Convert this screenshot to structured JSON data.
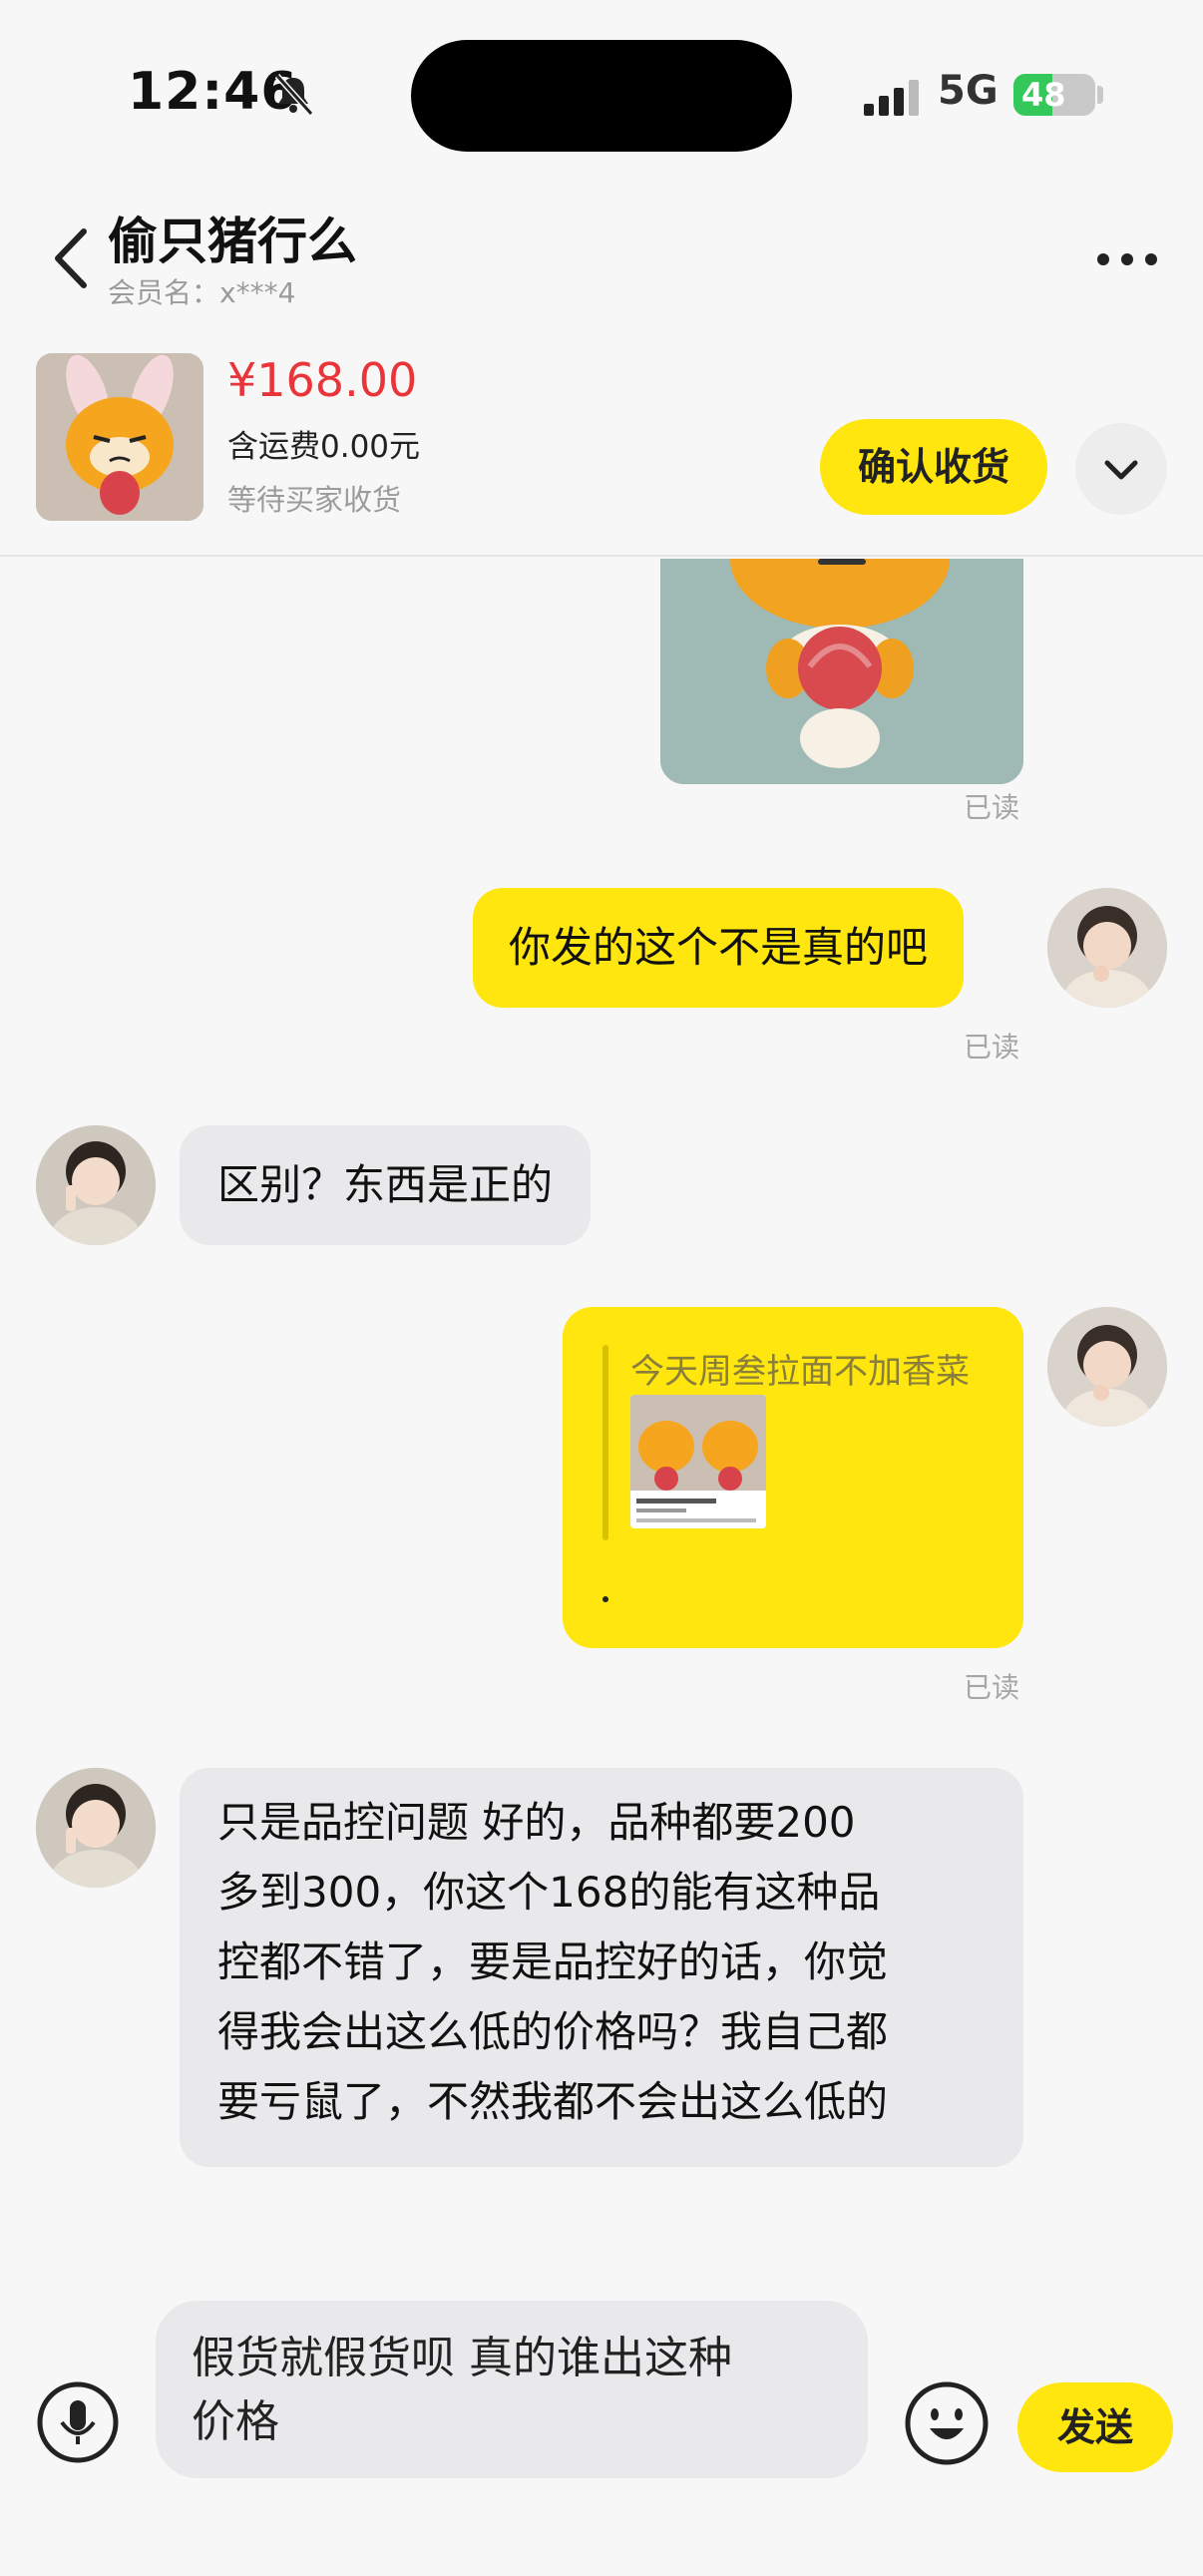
{
  "status_bar": {
    "time": "12:46",
    "network": "5G",
    "battery": "48",
    "battery_level": 0.48,
    "icons": [
      "bell-muted-icon",
      "signal-icon",
      "battery-charging-icon"
    ]
  },
  "header": {
    "title": "偷只猪行么",
    "member_label": "会员名：x***4",
    "icons": [
      "back-icon",
      "more-icon"
    ]
  },
  "product": {
    "price": "¥168.00",
    "shipping": "含运费0.00元",
    "status": "等待买家收货",
    "confirm_label": "确认收货",
    "expand_icon": "chevron-down-icon"
  },
  "messages": [
    {
      "side": "mine",
      "type": "image",
      "read": "已读"
    },
    {
      "side": "mine",
      "type": "text",
      "text": "你发的这个不是真的吧",
      "read": "已读"
    },
    {
      "side": "theirs",
      "type": "text",
      "text": "区别？东西是正的"
    },
    {
      "side": "mine",
      "type": "quote",
      "quote_user": "今天周叁拉面不加香菜",
      "read": "已读"
    },
    {
      "side": "theirs",
      "type": "text",
      "lines": [
        "只是品控问题 好的，品种都要200",
        "多到300，你这个168的能有这种品",
        "控都不错了，要是品控好的话，你觉",
        "得我会出这么低的价格吗？我自己都",
        "要亏鼠了，不然我都不会出这么低的"
      ]
    }
  ],
  "input_bar": {
    "draft_lines": [
      "假货就假货呗 真的谁出这种",
      "价格"
    ],
    "send_label": "发送",
    "icons": [
      "microphone-icon",
      "emoji-icon"
    ]
  },
  "colors": {
    "accent_yellow": "#ffe60f",
    "price_red": "#e8353a",
    "background": "#f7f7f7",
    "incoming_bubble": "#e9e9ec"
  }
}
